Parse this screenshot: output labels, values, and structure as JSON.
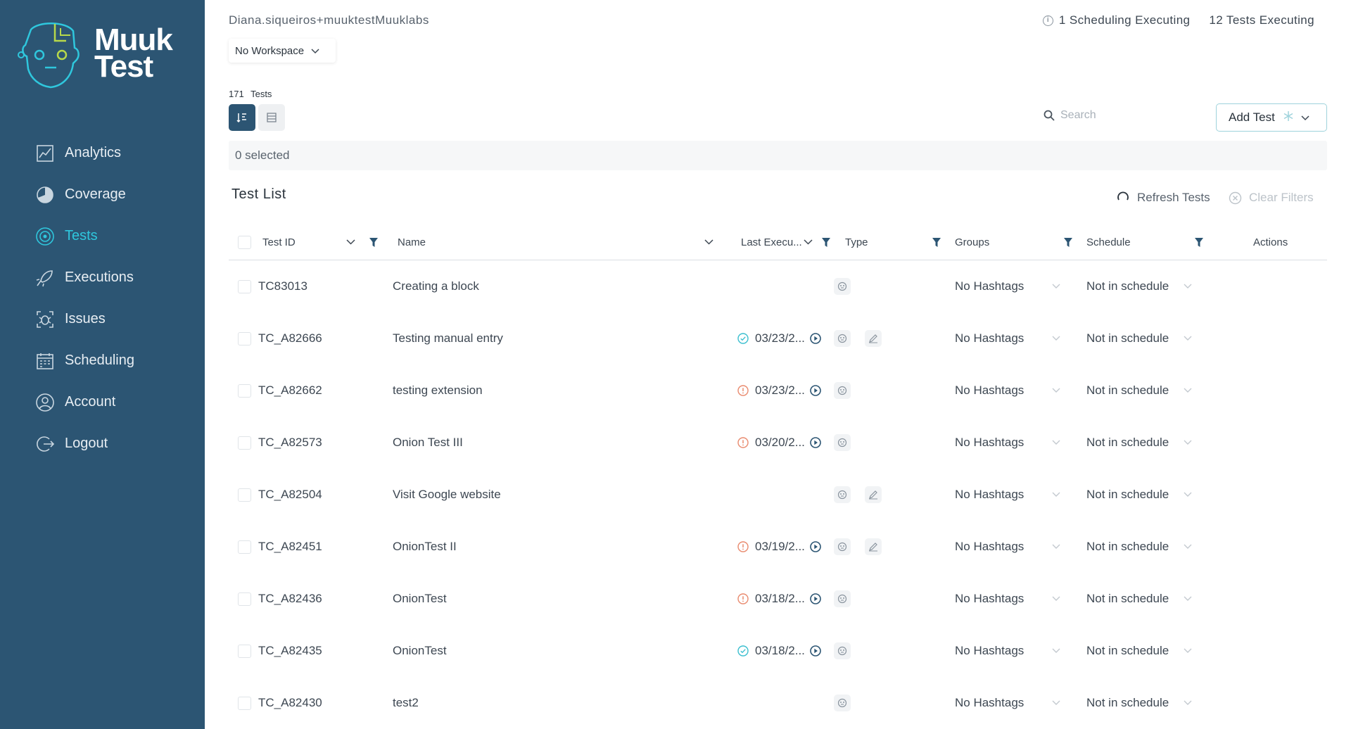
{
  "brand": {
    "line1": "Muuk",
    "line2": "Test"
  },
  "nav": [
    {
      "label": "Analytics",
      "icon": "analytics-icon",
      "active": false
    },
    {
      "label": "Coverage",
      "icon": "coverage-icon",
      "active": false
    },
    {
      "label": "Tests",
      "icon": "tests-icon",
      "active": true
    },
    {
      "label": "Executions",
      "icon": "executions-icon",
      "active": false
    },
    {
      "label": "Issues",
      "icon": "issues-icon",
      "active": false
    },
    {
      "label": "Scheduling",
      "icon": "scheduling-icon",
      "active": false
    },
    {
      "label": "Account",
      "icon": "account-icon",
      "active": false
    },
    {
      "label": "Logout",
      "icon": "logout-icon",
      "active": false
    }
  ],
  "header": {
    "user": "Diana.siqueiros+muuktestMuuklabs",
    "scheduling_status": "1 Scheduling Executing",
    "tests_status": "12 Tests Executing",
    "workspace": "No Workspace"
  },
  "tests_count": {
    "number": "171",
    "label": "Tests"
  },
  "search": {
    "placeholder": "Search"
  },
  "add_test_label": "Add Test",
  "selected_text": "0 selected",
  "list_title": "Test List",
  "refresh_label": "Refresh Tests",
  "clear_filters_label": "Clear Filters",
  "columns": {
    "test_id": "Test ID",
    "name": "Name",
    "last_execution": "Last Execu...",
    "type": "Type",
    "groups": "Groups",
    "schedule": "Schedule",
    "actions": "Actions"
  },
  "rows": [
    {
      "id": "TC83013",
      "name": "Creating a block",
      "status": "",
      "date": "",
      "edit": false,
      "groups": "No Hashtags",
      "schedule": "Not in schedule"
    },
    {
      "id": "TC_A82666",
      "name": "Testing manual entry",
      "status": "success",
      "date": "03/23/2...",
      "edit": true,
      "groups": "No Hashtags",
      "schedule": "Not in schedule"
    },
    {
      "id": "TC_A82662",
      "name": "testing extension",
      "status": "warning",
      "date": "03/23/2...",
      "edit": false,
      "groups": "No Hashtags",
      "schedule": "Not in schedule"
    },
    {
      "id": "TC_A82573",
      "name": "Onion Test III",
      "status": "warning",
      "date": "03/20/2...",
      "edit": false,
      "groups": "No Hashtags",
      "schedule": "Not in schedule"
    },
    {
      "id": "TC_A82504",
      "name": "Visit Google website",
      "status": "",
      "date": "",
      "edit": true,
      "groups": "No Hashtags",
      "schedule": "Not in schedule"
    },
    {
      "id": "TC_A82451",
      "name": "OnionTest II",
      "status": "warning",
      "date": "03/19/2...",
      "edit": true,
      "groups": "No Hashtags",
      "schedule": "Not in schedule"
    },
    {
      "id": "TC_A82436",
      "name": "OnionTest",
      "status": "warning",
      "date": "03/18/2...",
      "edit": false,
      "groups": "No Hashtags",
      "schedule": "Not in schedule"
    },
    {
      "id": "TC_A82435",
      "name": "OnionTest",
      "status": "success",
      "date": "03/18/2...",
      "edit": false,
      "groups": "No Hashtags",
      "schedule": "Not in schedule"
    },
    {
      "id": "TC_A82430",
      "name": "test2",
      "status": "",
      "date": "",
      "edit": false,
      "groups": "No Hashtags",
      "schedule": "Not in schedule"
    }
  ],
  "colors": {
    "sidebar": "#2c5573",
    "accent": "#2fc7dd",
    "success": "#3bbfcf",
    "warning": "#e98a6e"
  }
}
